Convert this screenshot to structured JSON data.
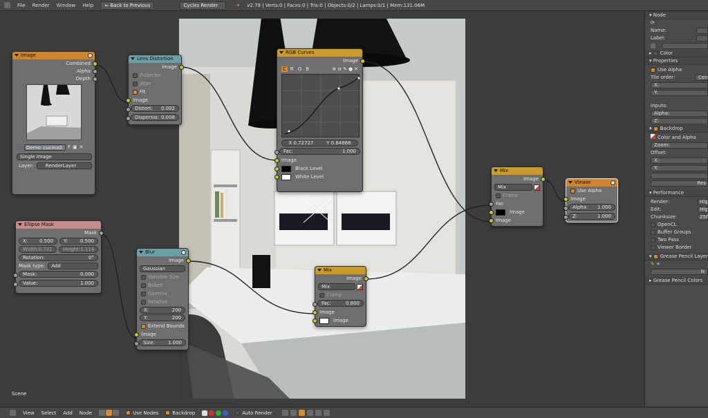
{
  "topbar": {
    "menus": [
      "File",
      "Render",
      "Window",
      "Help"
    ],
    "back_label": "Back to Previous",
    "engine": "Cycles Render",
    "stats": "v2.79 | Verts:0 | Faces:0 | Tris:0 | Objects:0/2 | Lamps:0/1 | Mem:131.06M"
  },
  "editor": {
    "scene_label": "Scene"
  },
  "nodes": {
    "image": {
      "title": "Image",
      "out_combined": "Combined",
      "out_alpha": "Alpha",
      "out_depth": "Depth",
      "file_name": "Demo_cucina0...",
      "file_flag": "F",
      "source": "Single Image",
      "layer_label": "Layer:",
      "layer_value": "RenderLayer"
    },
    "lens": {
      "title": "Lens Distortion",
      "out_image": "Image",
      "projector": "Projector",
      "jitter": "Jitter",
      "fit": "Fit",
      "in_image": "Image",
      "distort_label": "Distort:",
      "distort_value": "0.002",
      "dispersion_label": "Dispersio:",
      "dispersion_value": "0.008"
    },
    "rgb": {
      "title": "RGB Curves",
      "out_image": "Image",
      "tabs": [
        "C",
        "R",
        "G",
        "B"
      ],
      "x_readout": "X 0.72727",
      "y_readout": "Y 0.84868",
      "fac_label": "Fac:",
      "fac_value": "1.000",
      "in_image": "Image",
      "black_level": "Black Level",
      "white_level": "White Level"
    },
    "ellipse": {
      "title": "Ellipse Mask",
      "out_mask": "Mask",
      "x_label": "X:",
      "x_value": "0.500",
      "y_label": "Y:",
      "y_value": "0.500",
      "width_label": "Width:",
      "width_value": "0.731",
      "height_label": "Height:",
      "height_value": "1.114",
      "rotation_label": "Rotation:",
      "rotation_value": "0°",
      "masktype_label": "Mask type:",
      "masktype_value": "Add",
      "mask_label": "Mask:",
      "mask_value": "0.000",
      "value_label": "Value:",
      "value_value": "1.000"
    },
    "blur": {
      "title": "Blur",
      "out_image": "Image",
      "filter": "Gaussian",
      "variable_size": "Variable Size",
      "bokeh": "Bokeh",
      "gamma": "Gamma",
      "relative": "Relative",
      "x_label": "X:",
      "x_value": "200",
      "y_label": "Y:",
      "y_value": "200",
      "extend_bounds": "Extend Bounds",
      "in_image": "Image",
      "size_label": "Size:",
      "size_value": "1.000"
    },
    "mix1": {
      "title": "Mix",
      "out_image": "Image",
      "blend": "Mix",
      "clamp": "Clamp",
      "fac_label": "Fac:",
      "fac_value": "0.800",
      "in_image1": "Image",
      "in_image2": "Image"
    },
    "mix2": {
      "title": "Mix",
      "out_image": "Image",
      "blend": "Mix",
      "clamp": "Clamp",
      "fac_label": "Fac",
      "in_image1": "Image",
      "in_image2": "Image"
    },
    "viewer": {
      "title": "Viewer",
      "use_alpha": "Use Alpha",
      "in_image": "Image",
      "alpha_label": "Alpha:",
      "alpha_value": "1.000",
      "z_label": "Z:",
      "z_value": "1.000"
    }
  },
  "sidebar": {
    "node_header": "Node",
    "name_label": "Name:",
    "label_label": "Label:",
    "color_header": "Color",
    "properties_header": "Properties",
    "use_alpha": "Use Alpha",
    "tile_order_label": "Tile order:",
    "tile_order_value": "Cent",
    "x_label": "X:",
    "y_label": "Y:",
    "inputs_label": "Inputs:",
    "alpha_label": "Alpha:",
    "z_label": "Z:",
    "backdrop_header": "Backdrop",
    "color_and_alpha": "Color and Alpha",
    "zoom_label": "Zoom:",
    "offset_label": "Offset:",
    "reset_label": "Res",
    "performance_header": "Performance",
    "render_label": "Render:",
    "render_value": "High",
    "edit_label": "Edit:",
    "edit_value": "High",
    "chunksize_label": "Chunksize:",
    "chunksize_value": "256",
    "opencl": "OpenCL",
    "buffer_groups": "Buffer Groups",
    "two_pass": "Two Pass",
    "viewer_border": "Viewer Border",
    "grease_layers_header": "Grease Pencil Layers",
    "grease_new": "N",
    "grease_colors_header": "Grease Pencil Colors"
  },
  "bottombar": {
    "menus": [
      "View",
      "Select",
      "Add",
      "Node"
    ],
    "use_nodes": "Use Nodes",
    "backdrop": "Backdrop",
    "auto_render": "Auto Render"
  }
}
